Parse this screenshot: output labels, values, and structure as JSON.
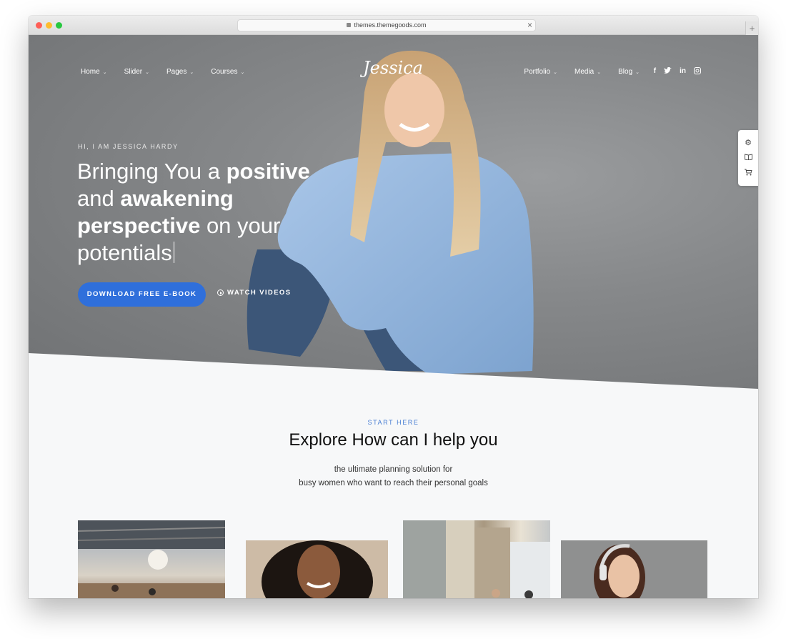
{
  "browser": {
    "url": "themes.themegoods.com",
    "new_tab": "+",
    "close": "×"
  },
  "nav": {
    "left": [
      {
        "label": "Home"
      },
      {
        "label": "Slider"
      },
      {
        "label": "Pages"
      },
      {
        "label": "Courses"
      }
    ],
    "right": [
      {
        "label": "Portfolio"
      },
      {
        "label": "Media"
      },
      {
        "label": "Blog"
      }
    ],
    "logo": "Jessica",
    "social_icons": [
      "facebook-icon",
      "twitter-icon",
      "linkedin-icon",
      "instagram-icon"
    ]
  },
  "hero": {
    "eyebrow": "HI, I AM JESSICA HARDY",
    "headline_parts": {
      "p1": "Bringing You a ",
      "b1": "positive",
      "p2": " and ",
      "b2": "awakening",
      "p3": " ",
      "b3": "perspective",
      "p4": " on your potentials"
    },
    "primary_button": "DOWNLOAD FREE E-BOOK",
    "secondary_button": "WATCH VIDEOS"
  },
  "side_tools": [
    "gear-icon",
    "book-icon",
    "cart-icon"
  ],
  "section": {
    "eyebrow": "START HERE",
    "title": "Explore How can I help you",
    "subtitle_line1": "the ultimate planning solution for",
    "subtitle_line2": "busy women who want to reach their personal goals"
  },
  "colors": {
    "accent": "#2f6fdb",
    "eyebrow_blue": "#4a7fd4"
  }
}
